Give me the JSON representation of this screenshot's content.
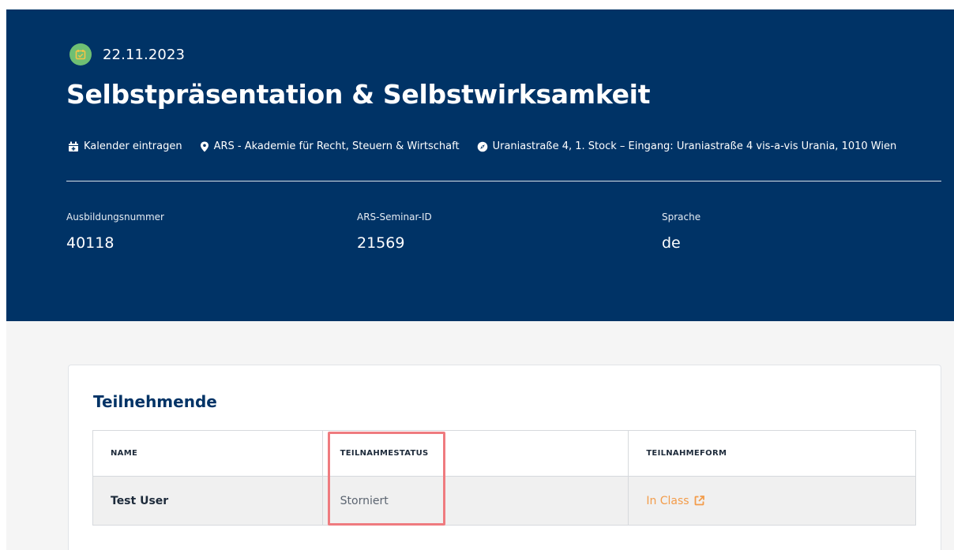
{
  "event": {
    "date": "22.11.2023",
    "title": "Selbstpräsentation & Selbstwirksamkeit",
    "calendar_label": "Kalender eintragen",
    "organizer": "ARS - Akademie für Recht, Steuern & Wirtschaft",
    "address": "Uraniastraße 4, 1. Stock – Eingang: Uraniastraße 4 vis-a-vis Urania, 1010 Wien"
  },
  "info": [
    {
      "label": "Ausbildungsnummer",
      "value": "40118"
    },
    {
      "label": "ARS-Seminar-ID",
      "value": "21569"
    },
    {
      "label": "Sprache",
      "value": "de"
    }
  ],
  "participants": {
    "title": "Teilnehmende",
    "columns": [
      "NAME",
      "TEILNAHMESTATUS",
      "TEILNAHMEFORM"
    ],
    "rows": [
      {
        "name": "Test User",
        "status": "Storniert",
        "form": "In Class"
      }
    ]
  },
  "icons": {
    "date": "calendar-check-icon",
    "calendar_add": "calendar-plus-icon",
    "location": "map-pin-icon",
    "address": "compass-icon",
    "external": "external-link-icon"
  },
  "colors": {
    "header_bg": "#003366",
    "date_badge": "#6fbf73",
    "link": "#f39c4a",
    "highlight": "#ef7b7f"
  }
}
